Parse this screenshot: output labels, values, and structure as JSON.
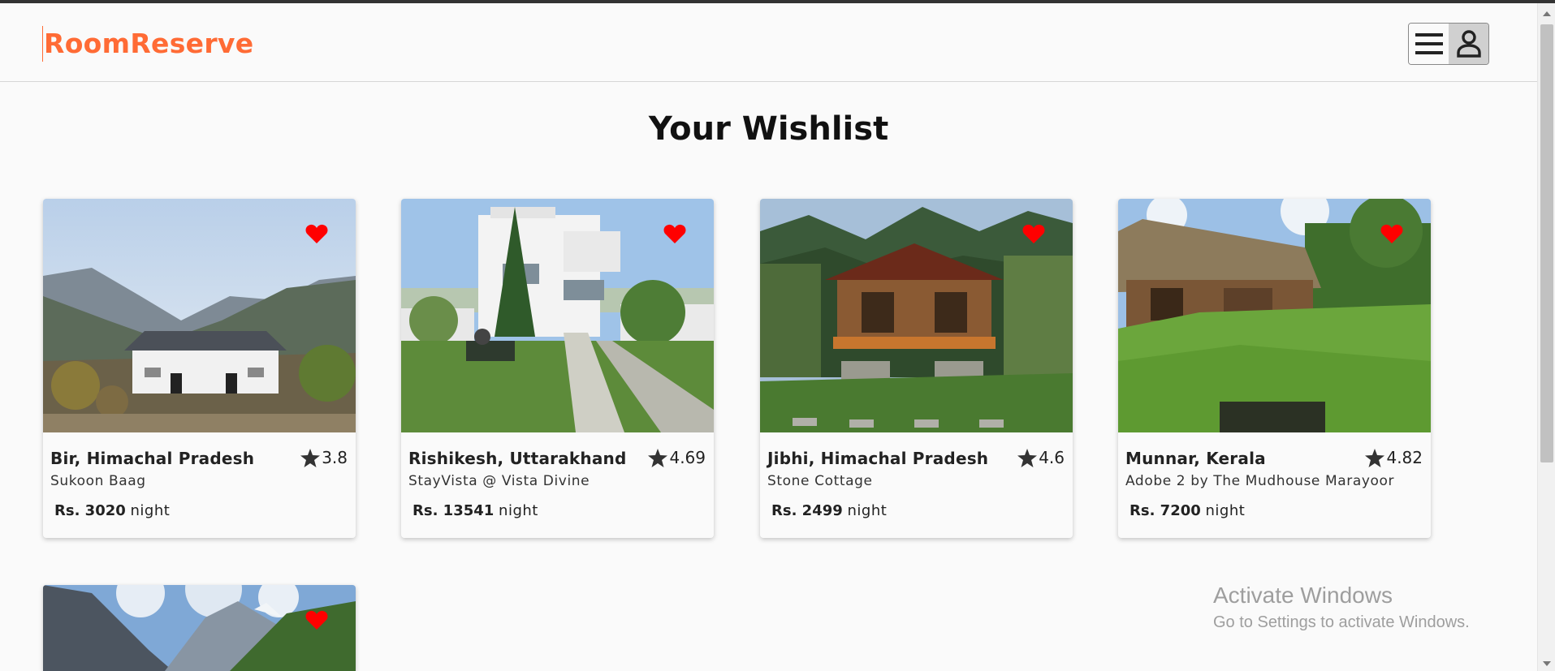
{
  "brand": {
    "name": "RoomReserve",
    "color": "#ff6b35"
  },
  "nav": {
    "menu_icon": "hamburger-icon",
    "user_icon": "user-icon"
  },
  "page": {
    "title": "Your Wishlist"
  },
  "listings": [
    {
      "location": "Bir, Himachal Pradesh",
      "rating": "3.8",
      "name": "Sukoon Baag",
      "price": "Rs. 3020",
      "unit": "night"
    },
    {
      "location": "Rishikesh, Uttarakhand",
      "rating": "4.69",
      "name": "StayVista @ Vista Divine",
      "price": "Rs. 13541",
      "unit": "night"
    },
    {
      "location": "Jibhi, Himachal Pradesh",
      "rating": "4.6",
      "name": "Stone Cottage",
      "price": "Rs. 2499",
      "unit": "night"
    },
    {
      "location": "Munnar, Kerala",
      "rating": "4.82",
      "name": "Adobe 2 by The Mudhouse Marayoor",
      "price": "Rs. 7200",
      "unit": "night"
    },
    {
      "location": "",
      "rating": "",
      "name": "",
      "price": "",
      "unit": ""
    }
  ],
  "icons": {
    "favorite": "heart-icon",
    "rating": "star-icon",
    "heart_color": "#ff0000"
  },
  "watermark": {
    "line1": "Activate Windows",
    "line2": "Go to Settings to activate Windows."
  }
}
